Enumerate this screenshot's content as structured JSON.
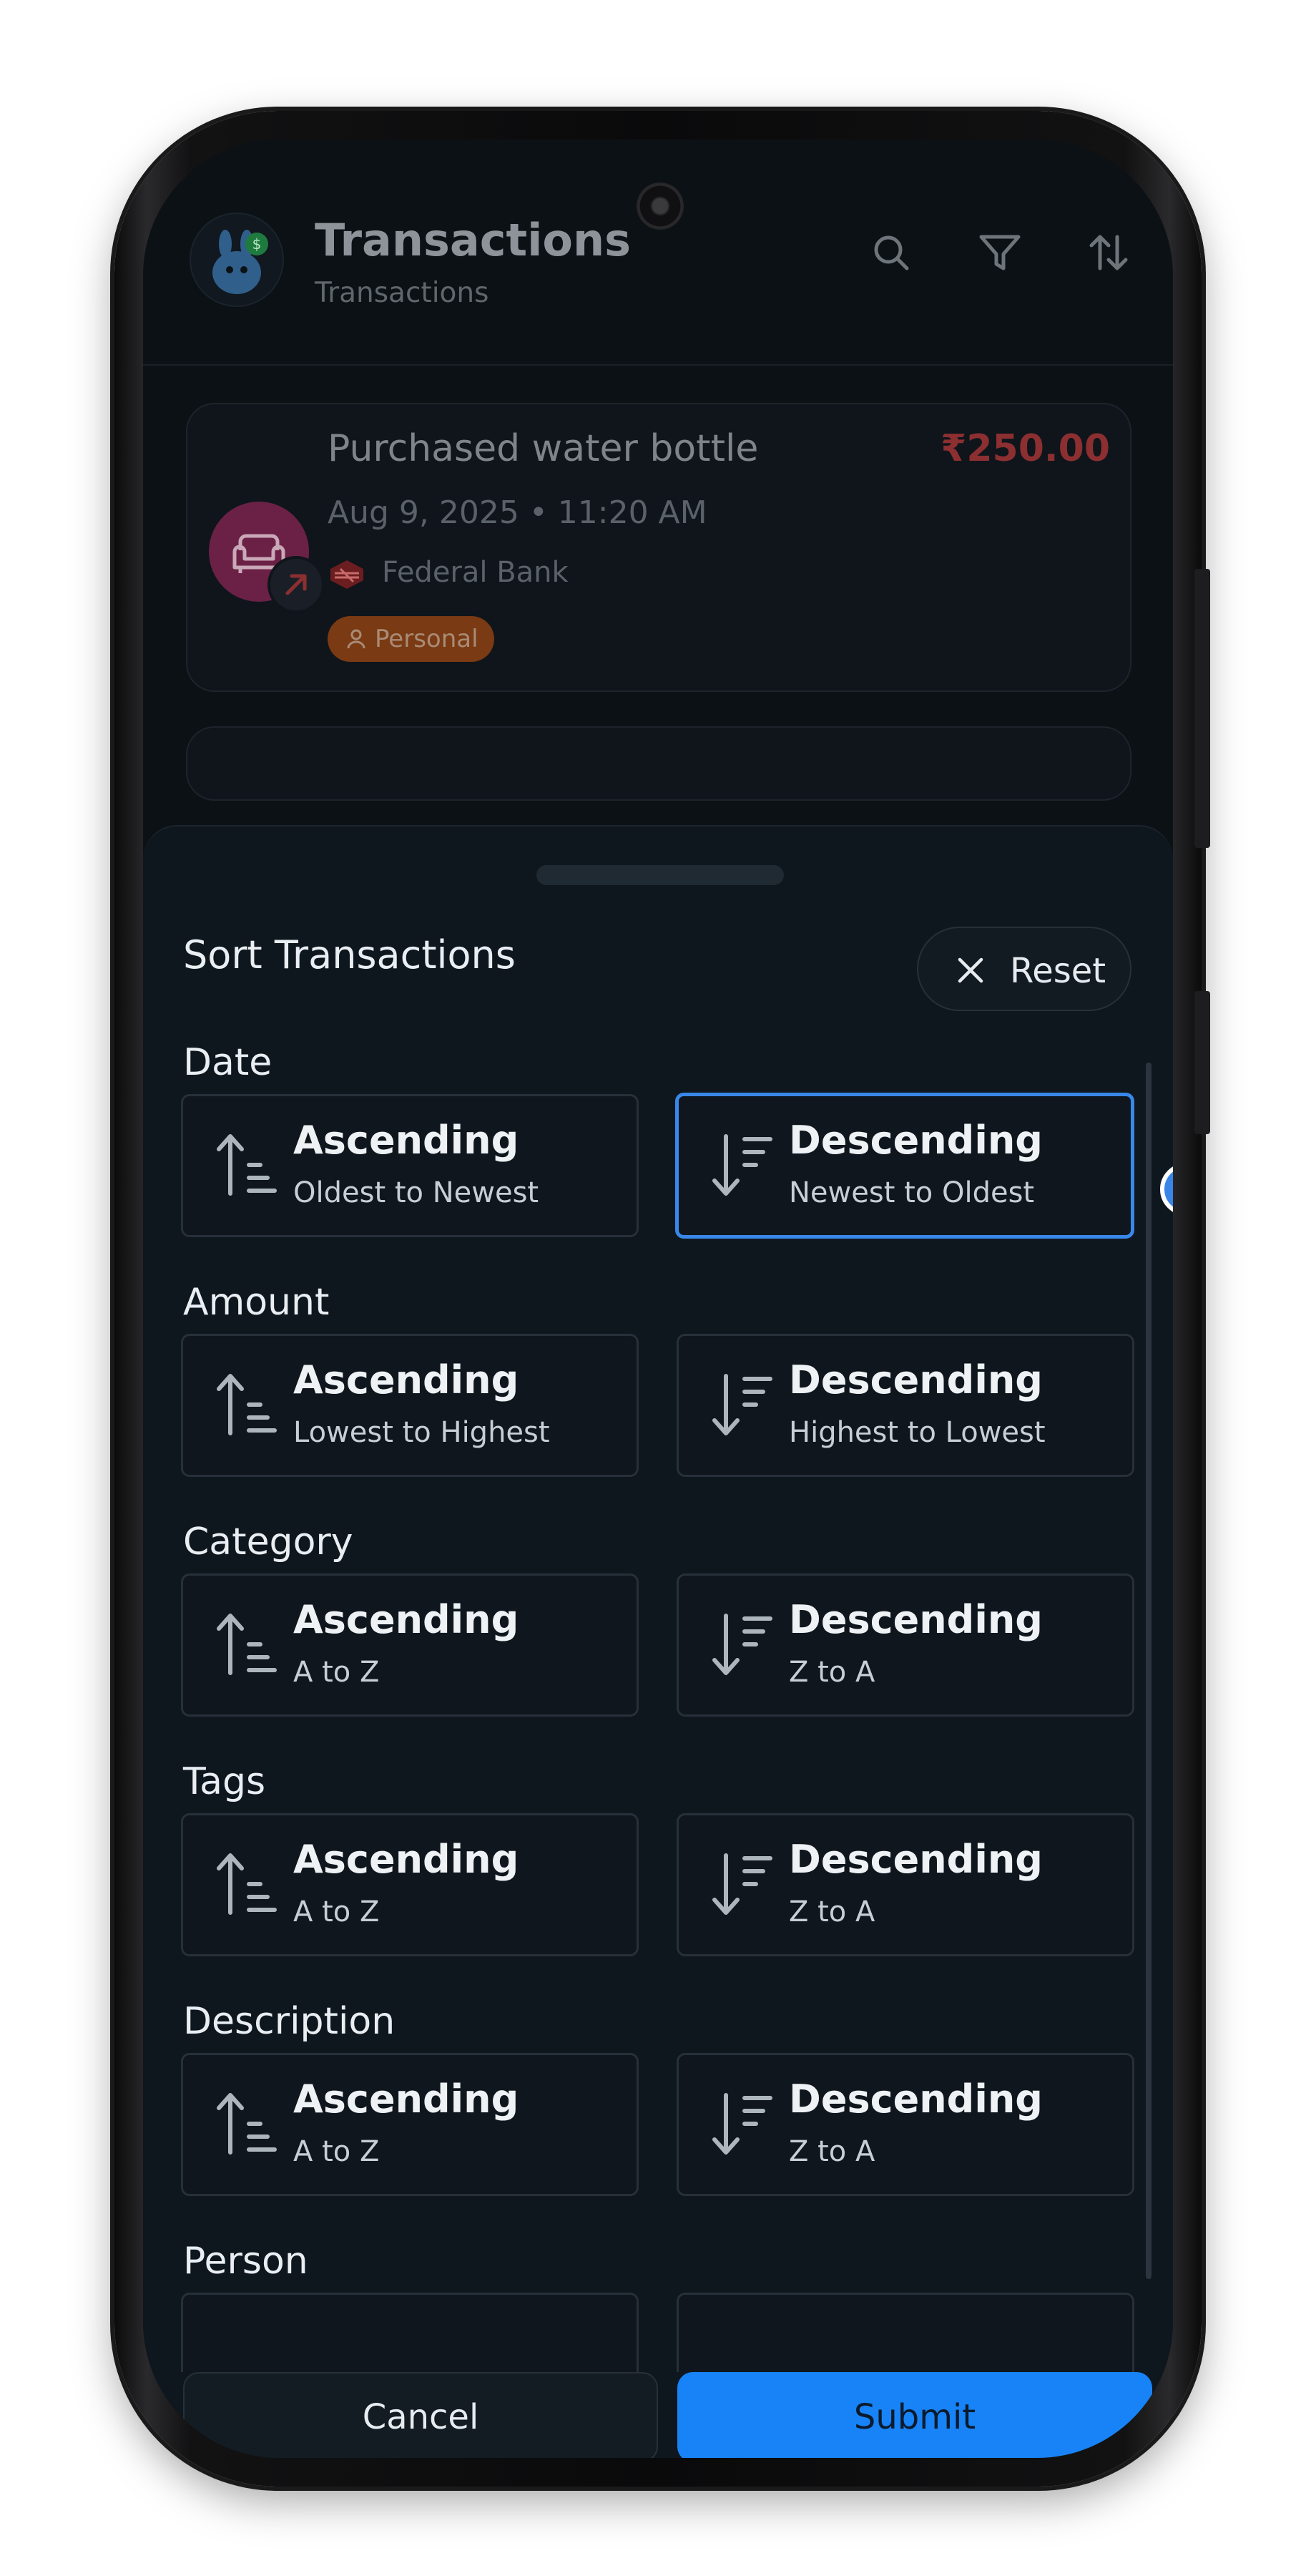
{
  "header": {
    "title": "Transactions",
    "subtitle": "Transactions",
    "icons": [
      "search-icon",
      "filter-icon",
      "sort-icon"
    ]
  },
  "transaction": {
    "description": "Purchased water bottle",
    "amount": "₹250.00",
    "datetime": "Aug 9, 2025 • 11:20 AM",
    "bank": "Federal Bank",
    "tag": "Personal",
    "category_icon": "sofa-icon",
    "direction_icon": "arrow-up-right-icon"
  },
  "sheet": {
    "title": "Sort Transactions",
    "reset_label": "Reset",
    "sections": [
      {
        "label": "Date",
        "asc": {
          "title": "Ascending",
          "sub": "Oldest to Newest"
        },
        "desc": {
          "title": "Descending",
          "sub": "Newest to Oldest"
        },
        "selected": "desc"
      },
      {
        "label": "Amount",
        "asc": {
          "title": "Ascending",
          "sub": "Lowest to Highest"
        },
        "desc": {
          "title": "Descending",
          "sub": "Highest to Lowest"
        }
      },
      {
        "label": "Category",
        "asc": {
          "title": "Ascending",
          "sub": "A to Z"
        },
        "desc": {
          "title": "Descending",
          "sub": "Z to A"
        }
      },
      {
        "label": "Tags",
        "asc": {
          "title": "Ascending",
          "sub": "A to Z"
        },
        "desc": {
          "title": "Descending",
          "sub": "Z to A"
        }
      },
      {
        "label": "Description",
        "asc": {
          "title": "Ascending",
          "sub": "A to Z"
        },
        "desc": {
          "title": "Descending",
          "sub": "Z to A"
        }
      },
      {
        "label": "Person"
      }
    ],
    "cancel_label": "Cancel",
    "submit_label": "Submit"
  },
  "colors": {
    "accent": "#1883f6",
    "selected_border": "#3987e9",
    "amount_debit": "#8c2f31",
    "tag_bg": "#7a3a13",
    "background": "#0f171e"
  }
}
